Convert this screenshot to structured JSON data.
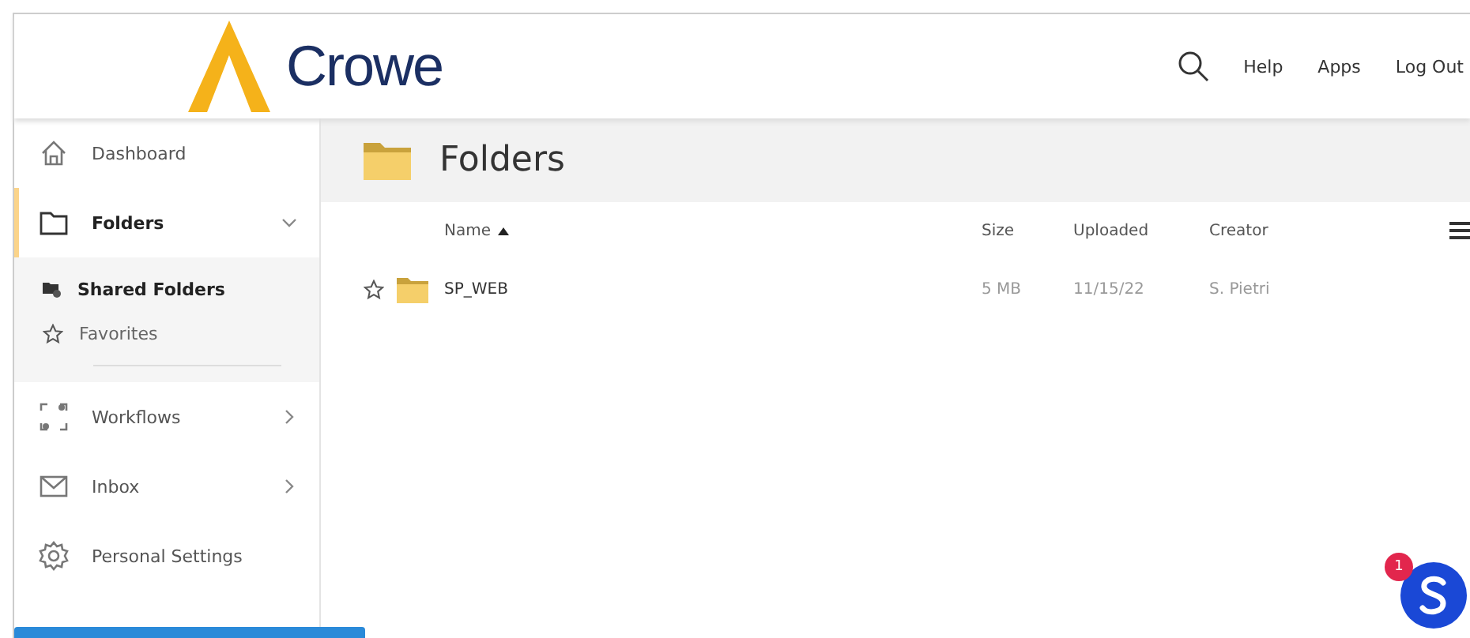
{
  "header": {
    "logo": "Crowe",
    "links": [
      "Help",
      "Apps",
      "Log Out"
    ]
  },
  "sidebar": {
    "items": [
      {
        "kind": "home",
        "label": "Dashboard",
        "selected": false
      },
      {
        "kind": "folder",
        "label": "Folders",
        "selected": true,
        "expanded": true,
        "children": [
          {
            "kind": "shared",
            "label": "Shared Folders",
            "selected": true
          },
          {
            "kind": "star",
            "label": "Favorites",
            "selected": false
          }
        ]
      },
      {
        "kind": "workflow",
        "label": "Workflows",
        "selected": false,
        "expanded": false
      },
      {
        "kind": "mail",
        "label": "Inbox",
        "selected": false,
        "expanded": false
      },
      {
        "kind": "gear",
        "label": "Personal Settings",
        "selected": false
      }
    ]
  },
  "page": {
    "title": "Folders"
  },
  "table": {
    "columns": [
      {
        "label": "Name",
        "sorted": true
      },
      {
        "label": "Size",
        "sorted": false
      },
      {
        "label": "Uploaded",
        "sorted": false
      },
      {
        "label": "Creator",
        "sorted": false
      }
    ],
    "rows": [
      {
        "name": "SP_WEB",
        "size": "5 MB",
        "uploaded": "11/15/22",
        "creator": "S. Pietri",
        "favorite": false
      }
    ]
  },
  "chat": {
    "badge": "1"
  }
}
